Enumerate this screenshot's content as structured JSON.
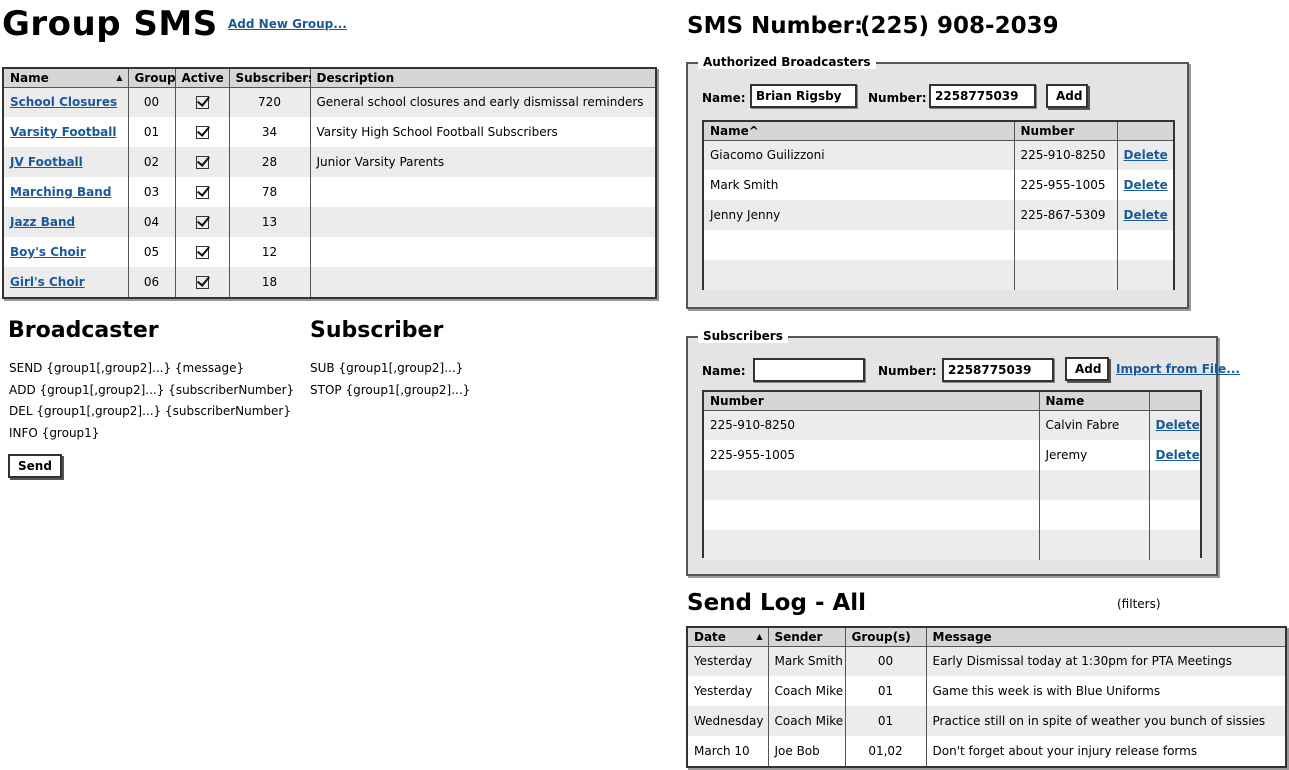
{
  "page": {
    "title": "Group SMS",
    "add_group_link": "Add New Group..."
  },
  "groups_table": {
    "headers": [
      "Name",
      "Group",
      "Active",
      "Subscribers",
      "Description"
    ],
    "rows": [
      {
        "name": "School Closures",
        "group": "00",
        "active": true,
        "subscribers": "720",
        "description": "General school closures and early dismissal reminders"
      },
      {
        "name": "Varsity Football",
        "group": "01",
        "active": true,
        "subscribers": "34",
        "description": "Varsity High School Football Subscribers"
      },
      {
        "name": "JV Football",
        "group": "02",
        "active": true,
        "subscribers": "28",
        "description": "Junior Varsity Parents"
      },
      {
        "name": "Marching Band",
        "group": "03",
        "active": true,
        "subscribers": "78",
        "description": ""
      },
      {
        "name": "Jazz Band",
        "group": "04",
        "active": true,
        "subscribers": "13",
        "description": ""
      },
      {
        "name": "Boy's Choir",
        "group": "05",
        "active": true,
        "subscribers": "12",
        "description": ""
      },
      {
        "name": "Girl's Choir",
        "group": "06",
        "active": true,
        "subscribers": "18",
        "description": ""
      }
    ]
  },
  "broadcaster": {
    "title": "Broadcaster",
    "commands": [
      "SEND {group1[,group2]...} {message}",
      "ADD {group1[,group2]...} {subscriberNumber}",
      "DEL {group1[,group2]...} {subscriberNumber}",
      "INFO {group1}"
    ],
    "send_label": "Send"
  },
  "subscriber": {
    "title": "Subscriber",
    "commands": [
      "SUB {group1[,group2]...}",
      "STOP {group1[,group2]...}"
    ]
  },
  "sms_number": {
    "label": "SMS Number:",
    "value": "(225) 908-2039"
  },
  "authorized": {
    "legend": "Authorized Broadcasters",
    "name_label": "Name:",
    "name_value": "Brian Rigsby",
    "number_label": "Number:",
    "number_value": "2258775039",
    "add_label": "Add",
    "headers": [
      "Name^",
      "Number",
      ""
    ],
    "rows": [
      {
        "name": "Giacomo Guilizzoni",
        "number": "225-910-8250",
        "action": "Delete"
      },
      {
        "name": "Mark Smith",
        "number": "225-955-1005",
        "action": "Delete"
      },
      {
        "name": "Jenny Jenny",
        "number": "225-867-5309",
        "action": "Delete"
      }
    ]
  },
  "subscribers": {
    "legend": "Subscribers",
    "name_label": "Name:",
    "name_value": "",
    "number_label": "Number:",
    "number_value": "2258775039",
    "add_label": "Add",
    "import_label": "Import from File...",
    "headers": [
      "Number",
      "Name",
      ""
    ],
    "rows": [
      {
        "number": "225-910-8250",
        "name": "Calvin Fabre",
        "action": "Delete"
      },
      {
        "number": "225-955-1005",
        "name": "Jeremy",
        "action": "Delete"
      }
    ]
  },
  "send_log": {
    "title": "Send Log - All",
    "filters_label": "(filters)",
    "headers": [
      "Date",
      "Sender",
      "Group(s)",
      "Message"
    ],
    "rows": [
      {
        "date": "Yesterday",
        "sender": "Mark Smith",
        "groups": "00",
        "message": "Early Dismissal today at 1:30pm for PTA Meetings"
      },
      {
        "date": "Yesterday",
        "sender": "Coach Mike",
        "groups": "01",
        "message": "Game this week is with Blue Uniforms"
      },
      {
        "date": "Wednesday",
        "sender": "Coach Mike",
        "groups": "01",
        "message": "Practice still on in spite of weather you bunch of sissies"
      },
      {
        "date": "March 10",
        "sender": "Joe Bob",
        "groups": "01,02",
        "message": "Don't forget about your injury release forms"
      }
    ]
  }
}
